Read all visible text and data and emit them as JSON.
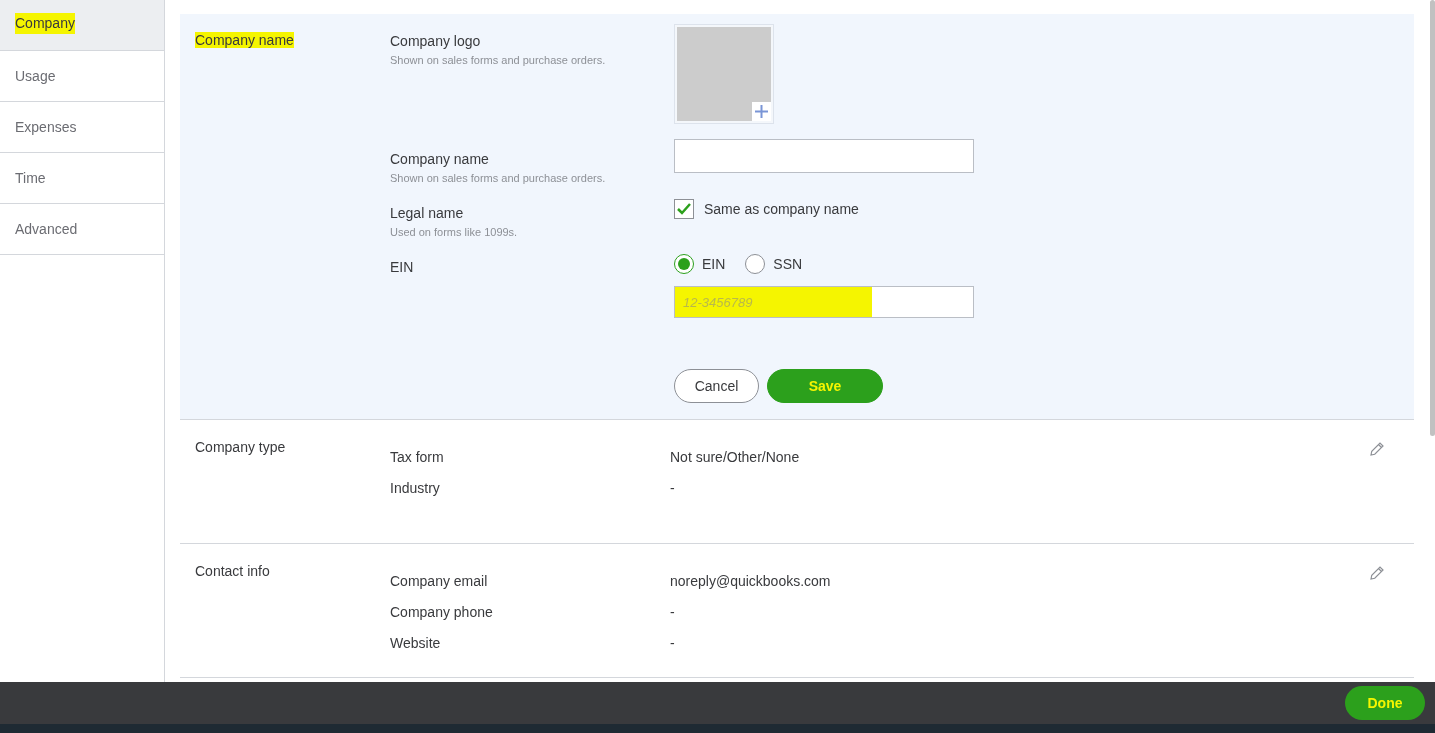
{
  "sidebar": {
    "items": [
      {
        "label": "Company",
        "selected": true,
        "highlighted": true
      },
      {
        "label": "Usage",
        "selected": false,
        "highlighted": false
      },
      {
        "label": "Expenses",
        "selected": false,
        "highlighted": false
      },
      {
        "label": "Time",
        "selected": false,
        "highlighted": false
      },
      {
        "label": "Advanced",
        "selected": false,
        "highlighted": false
      }
    ]
  },
  "editing_section": {
    "title": "Company name",
    "highlighted": true,
    "logo": {
      "label": "Company logo",
      "hint": "Shown on sales forms and purchase orders."
    },
    "name": {
      "label": "Company name",
      "hint": "Shown on sales forms and purchase orders."
    },
    "legal": {
      "label": "Legal name",
      "hint": "Used on forms like 1099s.",
      "checkbox": {
        "label": "Same as company name",
        "checked": true
      }
    },
    "tax_id": {
      "label": "EIN",
      "options": [
        {
          "label": "EIN",
          "selected": true
        },
        {
          "label": "SSN",
          "selected": false
        }
      ],
      "field": {
        "placeholder": "12-3456789",
        "highlighted": true
      }
    },
    "buttons": [
      {
        "label": "Cancel",
        "kind": "secondary",
        "highlighted": false
      },
      {
        "label": "Save",
        "kind": "primary",
        "highlighted": true
      }
    ]
  },
  "sections": [
    {
      "title": "Company type",
      "rows": [
        {
          "label": "Tax form",
          "value": "Not sure/Other/None"
        },
        {
          "label": "Industry",
          "value": "-"
        }
      ]
    },
    {
      "title": "Contact info",
      "rows": [
        {
          "label": "Company email",
          "value": "noreply@quickbooks.com"
        },
        {
          "label": "Company phone",
          "value": "-"
        },
        {
          "label": "Website",
          "value": "-"
        }
      ]
    }
  ],
  "footer": {
    "button": {
      "label": "Done",
      "highlighted": true
    }
  }
}
